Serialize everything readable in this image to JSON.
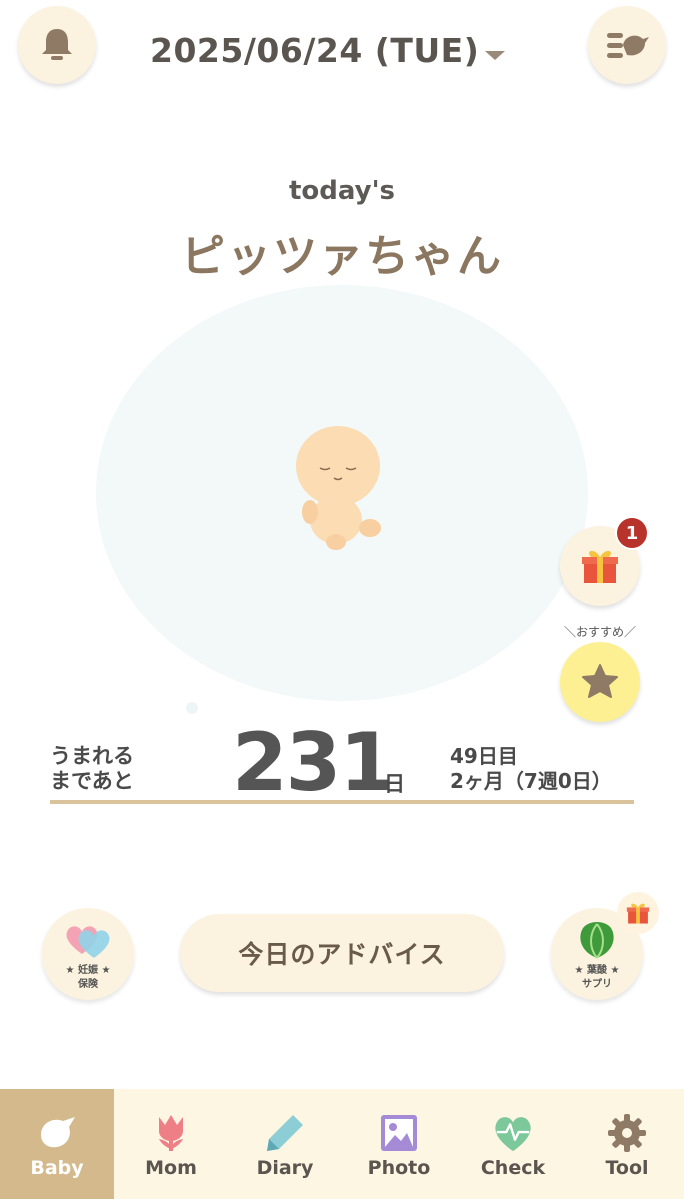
{
  "header": {
    "date": "2025/06/24 (TUE)",
    "bell_icon": "bell-icon",
    "menu_icon": "menu-bird-icon"
  },
  "main": {
    "today_label": "today's",
    "baby_name": "ピッツァちゃん",
    "days_until_label_line1": "うまれる",
    "days_until_label_line2": "まであと",
    "days_remaining": "231",
    "days_unit": "日",
    "day_of_month": "49日目",
    "age_info": "2ヶ月（7週0日）"
  },
  "side_actions": {
    "gift_badge_count": "1",
    "recommend_label": "＼おすすめ／"
  },
  "bottom_actions": {
    "insurance_line1": "★ 妊娠 ★",
    "insurance_line2": "保険",
    "advice_label": "今日のアドバイス",
    "folic_line1": "★ 葉酸 ★",
    "folic_line2": "サプリ"
  },
  "tabbar": {
    "active_tab": "Baby",
    "tabs": [
      {
        "label": "Baby",
        "icon": "bird-icon"
      },
      {
        "label": "Mom",
        "icon": "tulip-icon"
      },
      {
        "label": "Diary",
        "icon": "pen-icon"
      },
      {
        "label": "Photo",
        "icon": "photo-icon"
      },
      {
        "label": "Check",
        "icon": "heart-pulse-icon"
      },
      {
        "label": "Tool",
        "icon": "gear-icon"
      }
    ]
  },
  "colors": {
    "accent": "#d3b98c",
    "button_bg": "#fbf3df",
    "name_text": "#8b7660",
    "badge": "#b8332b",
    "star_bg": "#fdf093"
  }
}
